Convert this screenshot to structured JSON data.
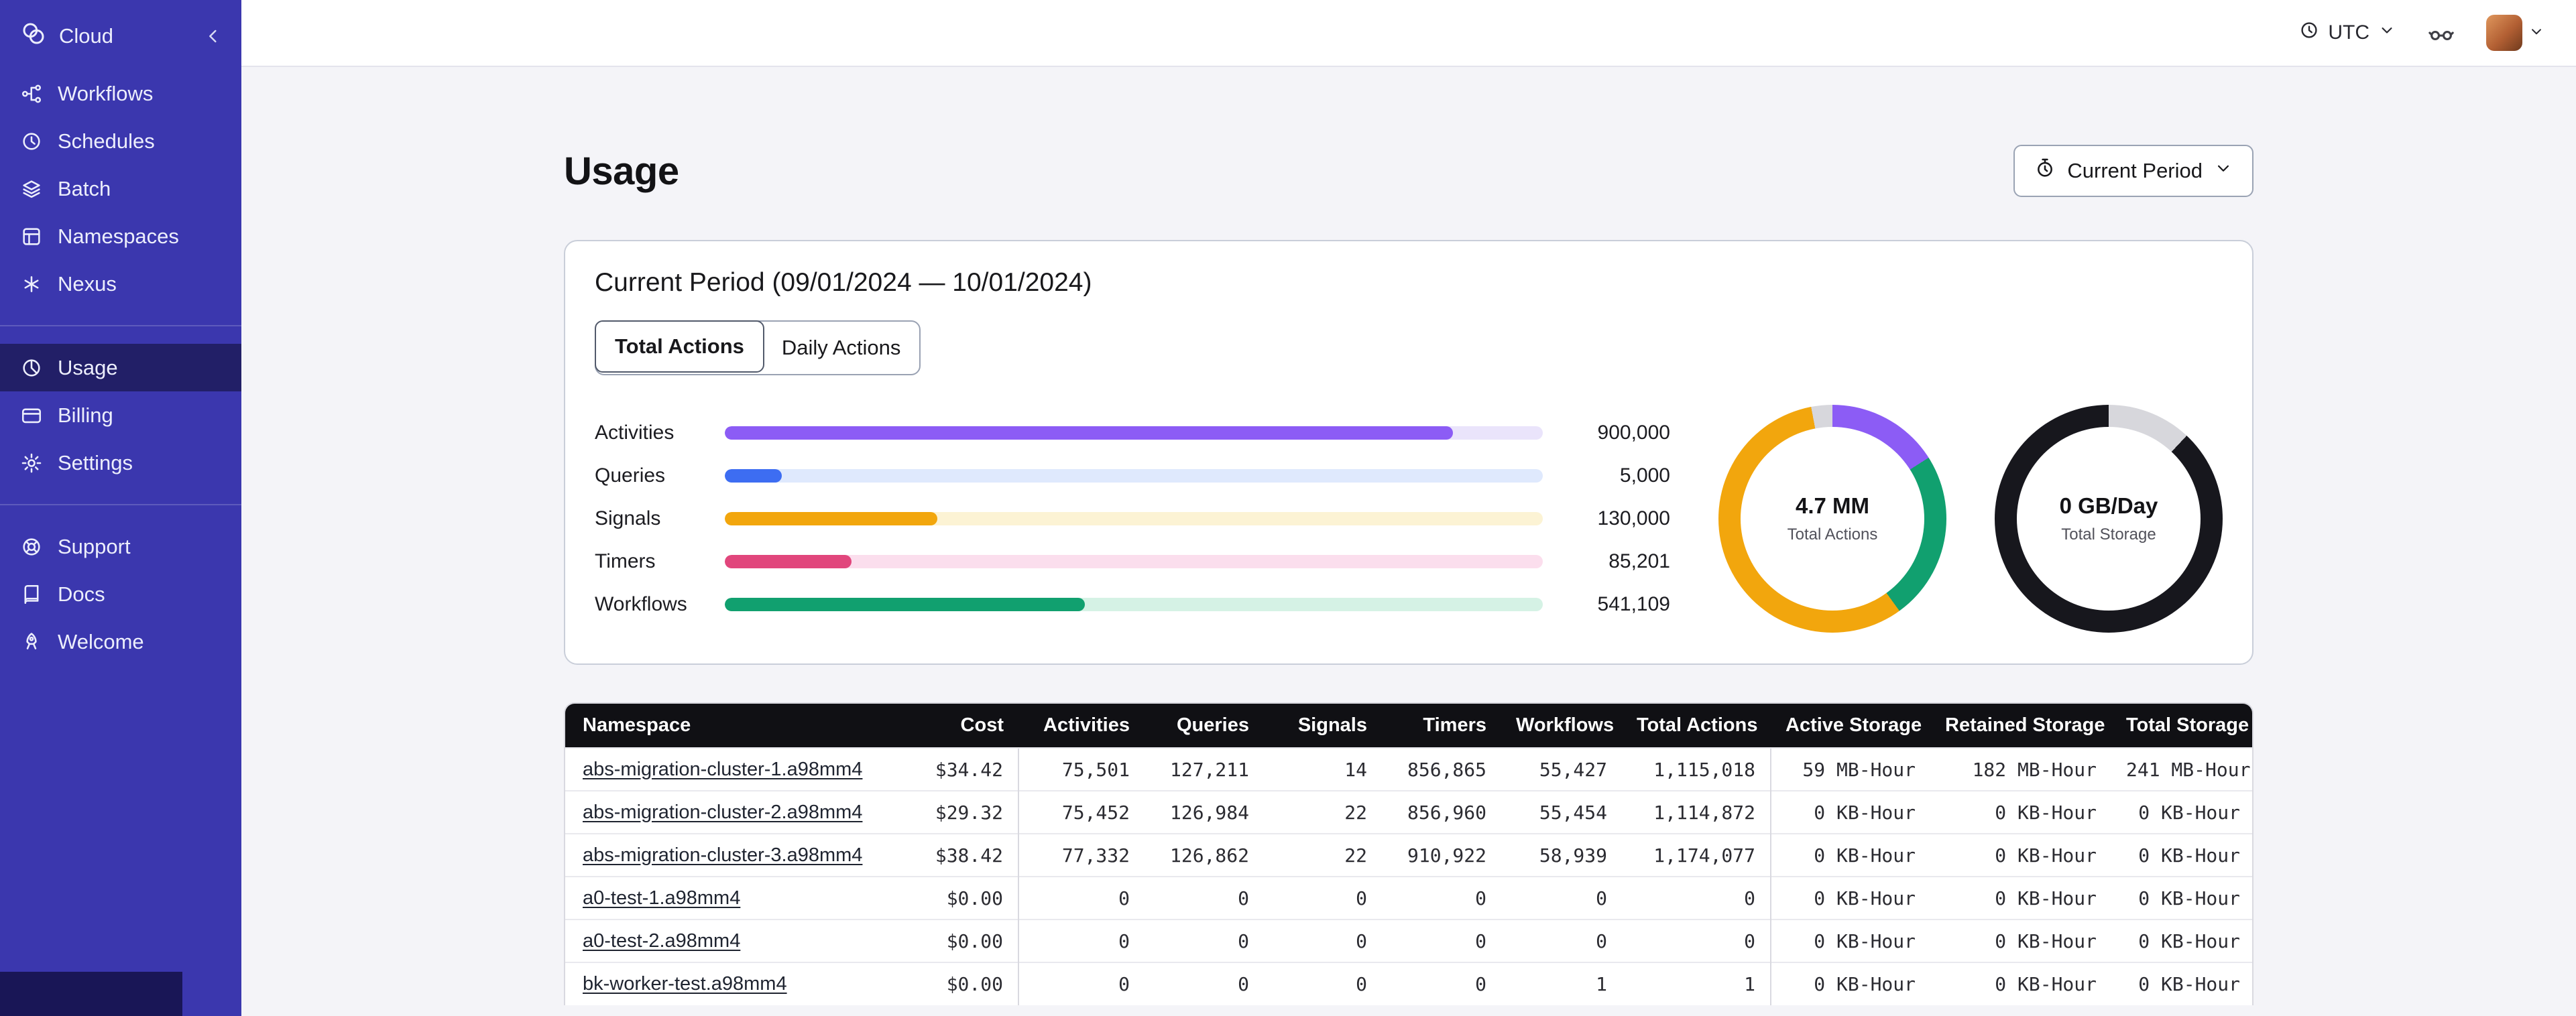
{
  "sidebar": {
    "brand": {
      "label": "Cloud"
    },
    "nav_main": [
      {
        "label": "Workflows",
        "icon": "workflows-icon"
      },
      {
        "label": "Schedules",
        "icon": "schedules-icon"
      },
      {
        "label": "Batch",
        "icon": "batch-icon"
      },
      {
        "label": "Namespaces",
        "icon": "namespaces-icon"
      },
      {
        "label": "Nexus",
        "icon": "nexus-icon"
      }
    ],
    "nav_account": [
      {
        "label": "Usage",
        "icon": "usage-icon",
        "active": true
      },
      {
        "label": "Billing",
        "icon": "billing-icon"
      },
      {
        "label": "Settings",
        "icon": "settings-icon"
      }
    ],
    "nav_support": [
      {
        "label": "Support",
        "icon": "support-icon"
      },
      {
        "label": "Docs",
        "icon": "docs-icon"
      },
      {
        "label": "Welcome",
        "icon": "welcome-icon"
      }
    ]
  },
  "topbar": {
    "timezone": "UTC"
  },
  "page": {
    "title": "Usage",
    "period_button": "Current Period"
  },
  "usage_card": {
    "title": "Current Period (09/01/2024 — 10/01/2024)",
    "tabs": [
      {
        "label": "Total Actions",
        "active": true
      },
      {
        "label": "Daily Actions",
        "active": false
      }
    ]
  },
  "chart_data": [
    {
      "type": "bar",
      "orientation": "horizontal",
      "categories": [
        "Activities",
        "Queries",
        "Signals",
        "Timers",
        "Workflows"
      ],
      "values": [
        900000,
        5000,
        130000,
        85201,
        541109
      ],
      "value_labels": [
        "900,000",
        "5,000",
        "130,000",
        "85,201",
        "541,109"
      ],
      "colors": [
        "#8c5cf5",
        "#3d6df2",
        "#f2a60d",
        "#e1467c",
        "#11a06f"
      ],
      "track_colors": [
        "#eae4fb",
        "#dfe9fd",
        "#fcf3d4",
        "#fbdeed",
        "#d5f2e5"
      ],
      "fill_pct": [
        89,
        7,
        26,
        15.5,
        44
      ]
    },
    {
      "type": "pie",
      "subtype": "donut",
      "center_value": "4.7 MM",
      "center_label": "Total Actions",
      "segments": [
        {
          "name": "activities",
          "pct": 16,
          "color": "#8c5cf5"
        },
        {
          "name": "workflows",
          "pct": 24,
          "color": "#11a06f"
        },
        {
          "name": "signals",
          "pct": 57,
          "color": "#f2a60d"
        },
        {
          "name": "other",
          "pct": 3,
          "color": "#d7d7dc"
        }
      ]
    },
    {
      "type": "pie",
      "subtype": "donut",
      "center_value": "0 GB/Day",
      "center_label": "Total Storage",
      "segments": [
        {
          "name": "retained",
          "pct": 12,
          "color": "#d7d7dc"
        },
        {
          "name": "active",
          "pct": 88,
          "color": "#17171d"
        }
      ]
    }
  ],
  "table": {
    "columns": [
      "Namespace",
      "Cost",
      "Activities",
      "Queries",
      "Signals",
      "Timers",
      "Workflows",
      "Total Actions",
      "Active Storage",
      "Retained Storage",
      "Total Storage"
    ],
    "rows": [
      [
        "abs-migration-cluster-1.a98mm4",
        "$34.42",
        "75,501",
        "127,211",
        "14",
        "856,865",
        "55,427",
        "1,115,018",
        "59 MB-Hour",
        "182 MB-Hour",
        "241 MB-Hour"
      ],
      [
        "abs-migration-cluster-2.a98mm4",
        "$29.32",
        "75,452",
        "126,984",
        "22",
        "856,960",
        "55,454",
        "1,114,872",
        "0 KB-Hour",
        "0 KB-Hour",
        "0 KB-Hour"
      ],
      [
        "abs-migration-cluster-3.a98mm4",
        "$38.42",
        "77,332",
        "126,862",
        "22",
        "910,922",
        "58,939",
        "1,174,077",
        "0 KB-Hour",
        "0 KB-Hour",
        "0 KB-Hour"
      ],
      [
        "a0-test-1.a98mm4",
        "$0.00",
        "0",
        "0",
        "0",
        "0",
        "0",
        "0",
        "0 KB-Hour",
        "0 KB-Hour",
        "0 KB-Hour"
      ],
      [
        "a0-test-2.a98mm4",
        "$0.00",
        "0",
        "0",
        "0",
        "0",
        "0",
        "0",
        "0 KB-Hour",
        "0 KB-Hour",
        "0 KB-Hour"
      ],
      [
        "bk-worker-test.a98mm4",
        "$0.00",
        "0",
        "0",
        "0",
        "0",
        "1",
        "1",
        "0 KB-Hour",
        "0 KB-Hour",
        "0 KB-Hour"
      ]
    ]
  }
}
